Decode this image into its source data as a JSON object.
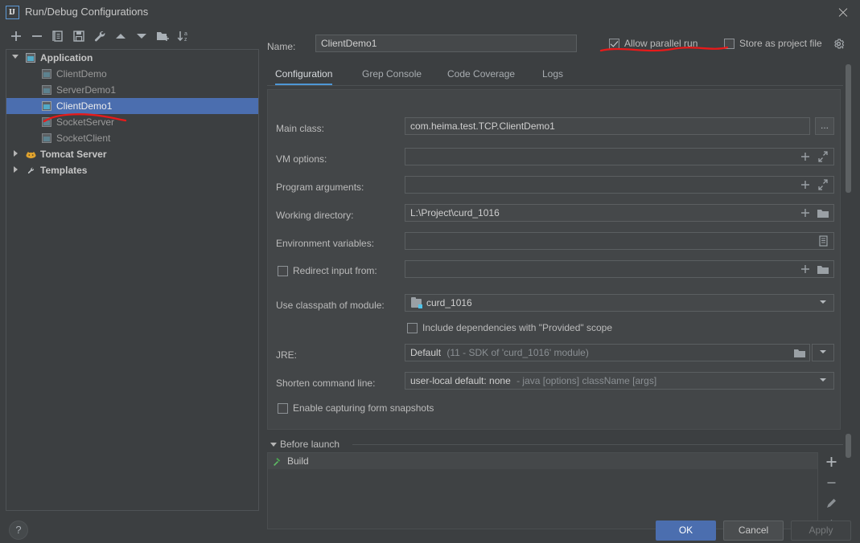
{
  "window": {
    "title": "Run/Debug Configurations",
    "logo_icon": "intellij-idea-icon",
    "close_icon": "close-icon"
  },
  "toolbar": {
    "buttons": [
      {
        "name": "add-configuration-button",
        "icon": "plus-icon",
        "glyph": "+"
      },
      {
        "name": "remove-configuration-button",
        "icon": "minus-icon",
        "glyph": "−"
      },
      {
        "name": "copy-configuration-button",
        "icon": "copy-icon",
        "glyph": "❐"
      },
      {
        "name": "save-configuration-button",
        "icon": "save-icon",
        "glyph": "Ὃe"
      },
      {
        "name": "edit-templates-button",
        "icon": "wrench-icon",
        "glyph": "ὒ7"
      },
      {
        "name": "move-up-button",
        "icon": "arrow-up-icon",
        "glyph": "▲"
      },
      {
        "name": "move-down-button",
        "icon": "arrow-down-icon",
        "glyph": "▼"
      },
      {
        "name": "new-folder-button",
        "icon": "folder-add-icon",
        "glyph": "Ὄ1"
      },
      {
        "name": "sort-alphabetically-button",
        "icon": "sort-az-icon",
        "glyph": "↓az"
      }
    ]
  },
  "tree": {
    "nodes": [
      {
        "label": "Application",
        "icon": "run-config-icon",
        "level": 0,
        "expanded": true,
        "selected": false,
        "bold": true
      },
      {
        "label": "ClientDemo",
        "icon": "run-config-icon",
        "level": 1,
        "selected": false,
        "bold": false
      },
      {
        "label": "ServerDemo1",
        "icon": "run-config-icon",
        "level": 1,
        "selected": false,
        "bold": false
      },
      {
        "label": "ClientDemo1",
        "icon": "run-config-icon",
        "level": 1,
        "selected": true,
        "bold": false
      },
      {
        "label": "SocketServer",
        "icon": "run-config-icon",
        "level": 1,
        "selected": false,
        "bold": false
      },
      {
        "label": "SocketClient",
        "icon": "run-config-icon",
        "level": 1,
        "selected": false,
        "bold": false
      },
      {
        "label": "Tomcat Server",
        "icon": "tomcat-icon",
        "level": 0,
        "expanded": false,
        "selected": false,
        "bold": true
      },
      {
        "label": "Templates",
        "icon": "wrench-icon",
        "level": 0,
        "expanded": false,
        "selected": false,
        "bold": true
      }
    ]
  },
  "help_button": {
    "label": "?",
    "name": "help-button"
  },
  "header": {
    "name_label": "Name:",
    "name_value": "ClientDemo1",
    "allow_parallel_run": {
      "label": "Allow parallel run",
      "checked": true
    },
    "store_as_project_file": {
      "label": "Store as project file",
      "checked": false
    },
    "gear_icon": "gear-icon"
  },
  "tabs": [
    {
      "label": "Configuration",
      "active": true
    },
    {
      "label": "Grep Console",
      "active": false
    },
    {
      "label": "Code Coverage",
      "active": false
    },
    {
      "label": "Logs",
      "active": false
    }
  ],
  "form": {
    "main_class": {
      "label": "Main class:",
      "value": "com.heima.test.TCP.ClientDemo1",
      "browse_label": "..."
    },
    "vm_options": {
      "label": "VM options:",
      "value": "",
      "icons": [
        "plus-icon",
        "expand-icon"
      ]
    },
    "program_arguments": {
      "label": "Program arguments:",
      "value": "",
      "icons": [
        "plus-icon",
        "expand-icon"
      ]
    },
    "working_directory": {
      "label": "Working directory:",
      "value": "L:\\Project\\curd_1016",
      "icons": [
        "plus-icon",
        "folder-icon"
      ]
    },
    "environment_variables": {
      "label": "Environment variables:",
      "value": "",
      "icons": [
        "list-icon"
      ]
    },
    "redirect_input_from": {
      "label": "Redirect input from:",
      "checked": false,
      "value": "",
      "icons": [
        "plus-icon",
        "folder-icon"
      ]
    },
    "use_classpath_of_module": {
      "label": "Use classpath of module:",
      "value": "curd_1016",
      "icon": "module-icon"
    },
    "include_provided_scope": {
      "label": "Include dependencies with \"Provided\" scope",
      "checked": false
    },
    "jre": {
      "label": "JRE:",
      "value": "Default",
      "hint": "(11 - SDK of 'curd_1016' module)",
      "icons": [
        "folder-icon",
        "chevron-down-icon"
      ]
    },
    "shorten_command_line": {
      "label": "Shorten command line:",
      "value": "user-local default: none",
      "hint": "- java [options] className [args]"
    },
    "enable_form_snapshots": {
      "label": "Enable capturing form snapshots",
      "checked": false
    }
  },
  "before_launch": {
    "title": "Before launch",
    "expanded": true,
    "items": [
      {
        "label": "Build",
        "icon": "hammer-icon"
      }
    ],
    "side_buttons": [
      {
        "name": "add-task-button",
        "icon": "plus-icon",
        "glyph": "+"
      },
      {
        "name": "remove-task-button",
        "icon": "minus-icon",
        "glyph": "−"
      },
      {
        "name": "edit-task-button",
        "icon": "pencil-icon",
        "glyph": "✎"
      },
      {
        "name": "move-task-up-button",
        "icon": "arrow-up-icon",
        "glyph": "▲"
      }
    ]
  },
  "footer": {
    "ok": "OK",
    "cancel": "Cancel",
    "apply": "Apply"
  },
  "annotations": {
    "color": "#e81a1a",
    "marks": [
      "underline-under-allow-parallel-run",
      "underline-under-socketserver"
    ]
  }
}
